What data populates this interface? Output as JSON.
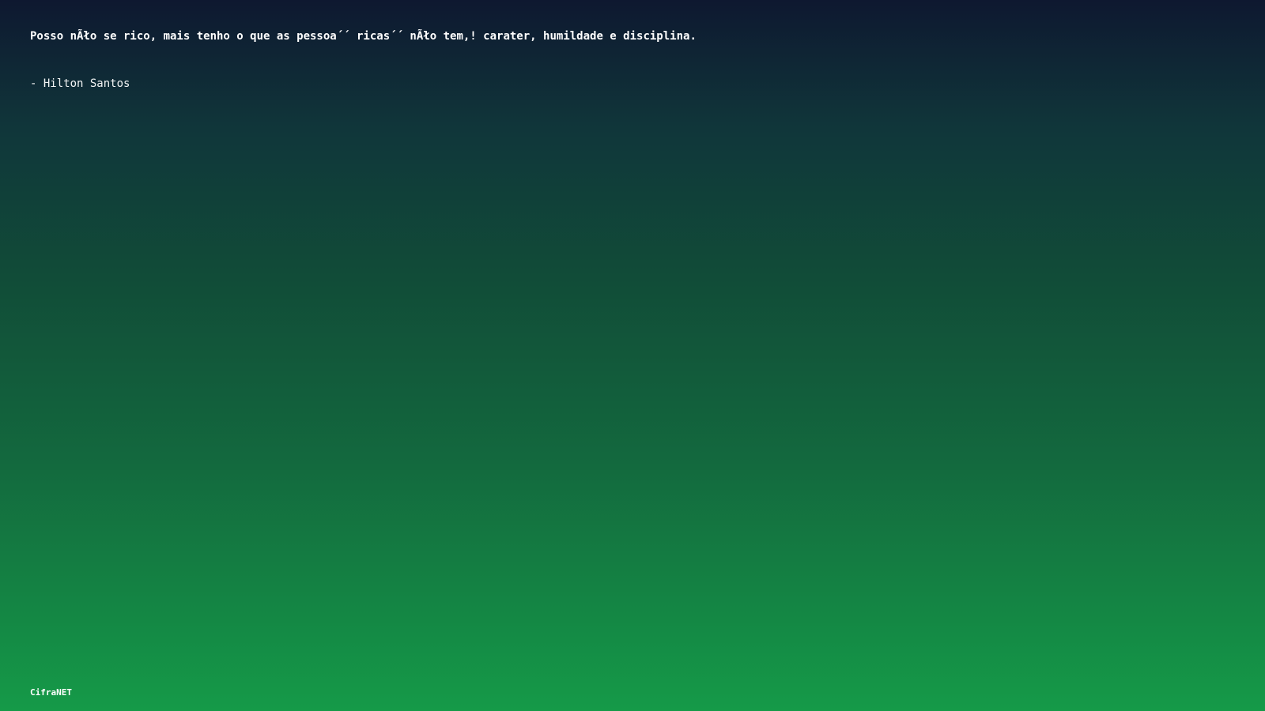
{
  "quote": {
    "text": "Posso nÃło se rico, mais tenho o que as pessoa´´ ricas´´ nÃło tem,! carater, humildade e disciplina.",
    "author": "- Hilton Santos"
  },
  "brand": {
    "name": "CifraNET"
  },
  "colors": {
    "gradient_top": "#0e1830",
    "gradient_bottom": "#159a48",
    "text": "#ffffff"
  }
}
